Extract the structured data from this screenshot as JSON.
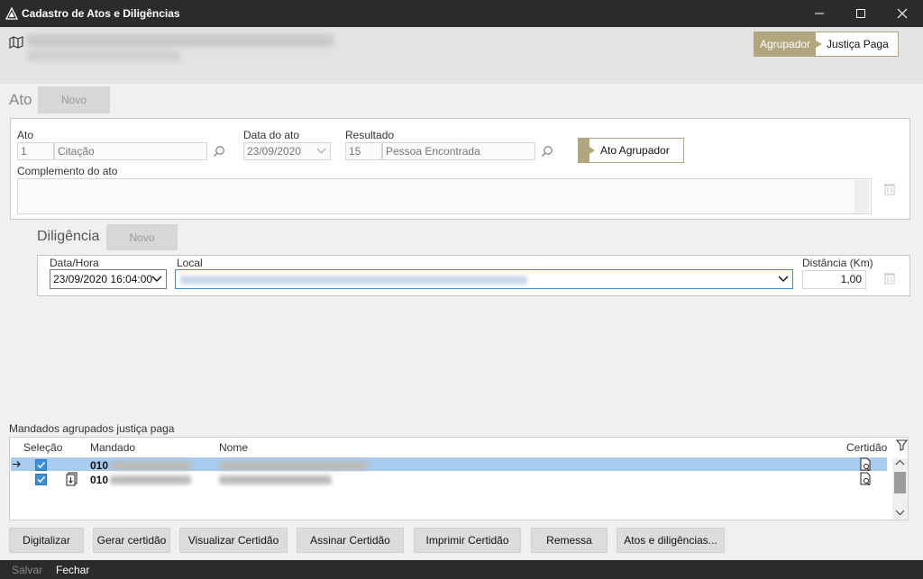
{
  "window": {
    "title": "Cadastro de Atos e Diligências",
    "minimize": "—",
    "maximize": "☐",
    "close": "✕"
  },
  "header": {
    "toggle_left": "Agrupador",
    "toggle_right": "Justiça Paga"
  },
  "ato": {
    "section_title": "Ato",
    "novo_label": "Novo",
    "ato_label": "Ato",
    "ato_code": "1",
    "ato_name": "Citação",
    "data_label": "Data do ato",
    "data_value": "23/09/2020",
    "resultado_label": "Resultado",
    "resultado_code": "15",
    "resultado_name": "Pessoa Encontrada",
    "agrupador_label": "Ato Agrupador",
    "complemento_label": "Complemento do ato"
  },
  "diligencia": {
    "section_title": "Diligência",
    "novo_label": "Novo",
    "datahora_label": "Data/Hora",
    "datahora_value": "23/09/2020 16:04:00",
    "local_label": "Local",
    "distancia_label": "Distância (Km)",
    "distancia_value": "1,00"
  },
  "grid": {
    "title": "Mandados agrupados justiça paga",
    "columns": {
      "selecao": "Seleção",
      "mandado": "Mandado",
      "nome": "Nome",
      "certidao": "Certidão"
    },
    "rows": [
      {
        "mandado": "010",
        "selected": true
      },
      {
        "mandado": "010",
        "selected": true
      }
    ]
  },
  "actions": {
    "digitalizar": "Digitalizar",
    "gerar": "Gerar certidão",
    "visualizar": "Visualizar Certidão",
    "assinar": "Assinar Certidão",
    "imprimir": "Imprimir Certidão",
    "remessa": "Remessa",
    "atos": "Atos e diligências..."
  },
  "footer": {
    "salvar": "Salvar",
    "fechar": "Fechar"
  },
  "colors": {
    "accent_gold": "#b1a67e",
    "selection_blue": "#a9cbee",
    "focus_blue": "#3a8fd6",
    "titlebar": "#2b2b2b"
  }
}
